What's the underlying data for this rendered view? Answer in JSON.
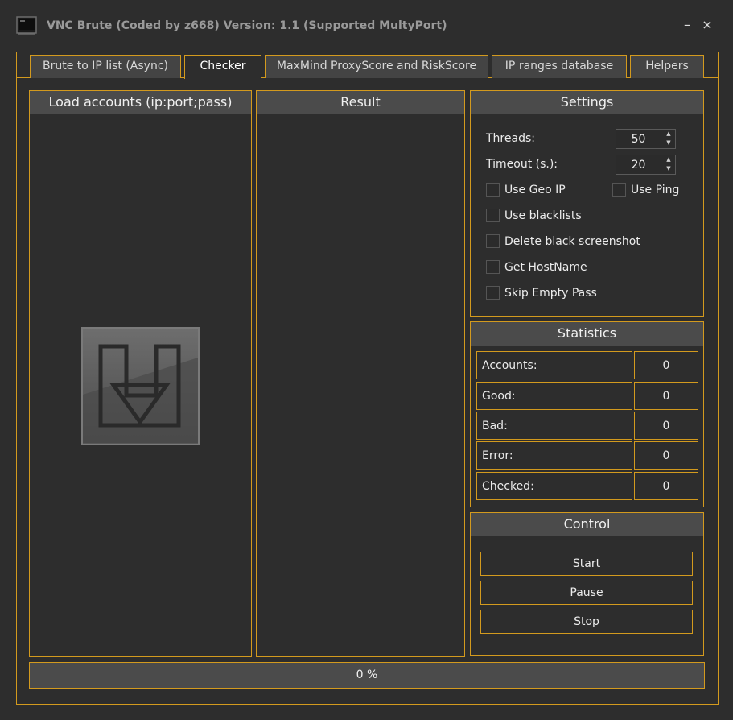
{
  "window": {
    "title": "VNC Brute (Coded by z668) Version: 1.1 (Supported MultyPort)",
    "minimize_glyph": "–",
    "close_glyph": "×",
    "icon": "terminal-icon"
  },
  "tabs": [
    {
      "label": "Brute to IP list (Async)",
      "active": false
    },
    {
      "label": "Checker",
      "active": true
    },
    {
      "label": "MaxMind ProxyScore and RiskScore",
      "active": false
    },
    {
      "label": "IP ranges database",
      "active": false
    },
    {
      "label": "Helpers",
      "active": false
    }
  ],
  "load_panel": {
    "title": "Load accounts (ip:port;pass)",
    "icon": "download-arrow-icon"
  },
  "result_panel": {
    "title": "Result"
  },
  "settings": {
    "title": "Settings",
    "threads_label": "Threads:",
    "threads_value": "50",
    "timeout_label": "Timeout (s.):",
    "timeout_value": "20",
    "use_geo_ip": "Use Geo IP",
    "use_ping": "Use Ping",
    "use_blacklists": "Use blacklists",
    "delete_black_screenshot": "Delete black screenshot",
    "get_hostname": "Get HostName",
    "skip_empty_pass": "Skip Empty Pass"
  },
  "statistics": {
    "title": "Statistics",
    "rows": [
      {
        "label": "Accounts:",
        "value": "0"
      },
      {
        "label": "Good:",
        "value": "0"
      },
      {
        "label": "Bad:",
        "value": "0"
      },
      {
        "label": "Error:",
        "value": "0"
      },
      {
        "label": "Checked:",
        "value": "0"
      }
    ]
  },
  "control": {
    "title": "Control",
    "start": "Start",
    "pause": "Pause",
    "stop": "Stop"
  },
  "progress": {
    "text": "0 %",
    "value": 0
  },
  "colors": {
    "accent": "#d39a1e",
    "background": "#2d2d2d",
    "header": "#4b4b4b"
  }
}
